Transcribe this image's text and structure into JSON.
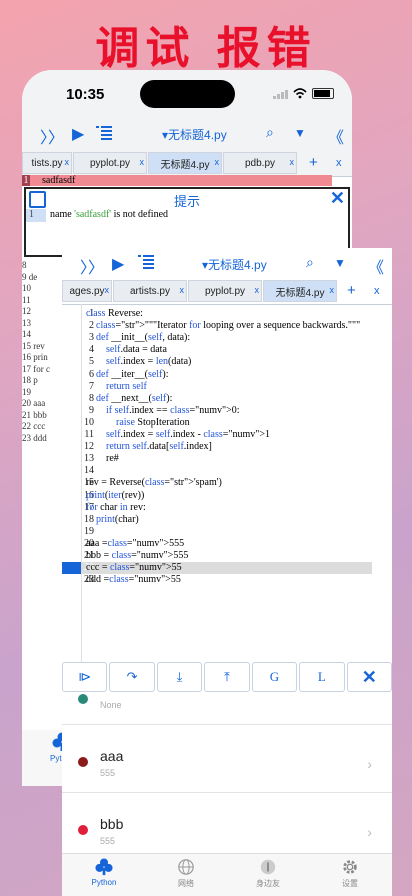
{
  "headline": "调试 报错",
  "status": {
    "time": "10:35"
  },
  "toolbar": {
    "filename": "无标题4.py",
    "filename_front": "无标题4.py"
  },
  "back_tabs": [
    {
      "label": "tists.py"
    },
    {
      "label": "pyplot.py"
    },
    {
      "label": "无标题4.py"
    },
    {
      "label": "pdb.py"
    }
  ],
  "tab_close": "x",
  "error_line": {
    "num": "1",
    "text": "sadfasdf"
  },
  "prompt": {
    "title": "提示",
    "line_num": "1",
    "msg_pre": "name ",
    "msg_name": "'sadfasdf'",
    "msg_post": " is not defined"
  },
  "back_code_lines": [
    "8",
    "9      de",
    "10",
    "11",
    "12",
    "13",
    "14",
    "15    rev",
    "16    prin",
    "17    for c",
    "18        p",
    "19",
    "20    aaa",
    "21    bbb",
    "22    ccc",
    "23    ddd"
  ],
  "back_tabbar": {
    "python": "Pyt"
  },
  "front_tabs": [
    {
      "label": "ages.py"
    },
    {
      "label": "artists.py"
    },
    {
      "label": "pyplot.py"
    },
    {
      "label": "无标题4.py"
    }
  ],
  "code": [
    {
      "n": "1",
      "t": "class Reverse:"
    },
    {
      "n": "2",
      "t": "    \"\"\"Iterator for looping over a sequence backwards.\"\"\""
    },
    {
      "n": "3",
      "t": "    def __init__(self, data):"
    },
    {
      "n": "4",
      "t": "        self.data = data"
    },
    {
      "n": "5",
      "t": "        self.index = len(data)"
    },
    {
      "n": "6",
      "t": "    def __iter__(self):"
    },
    {
      "n": "7",
      "t": "        return self"
    },
    {
      "n": "8",
      "t": "    def __next__(self):"
    },
    {
      "n": "9",
      "t": "        if self.index == 0:"
    },
    {
      "n": "10",
      "t": "            raise StopIteration"
    },
    {
      "n": "11",
      "t": "        self.index = self.index - 1"
    },
    {
      "n": "12",
      "t": "        return self.data[self.index]"
    },
    {
      "n": "13",
      "t": "        re#"
    },
    {
      "n": "14",
      "t": ""
    },
    {
      "n": "15",
      "t": "rev = Reverse('spam')"
    },
    {
      "n": "16",
      "t": "print(iter(rev))"
    },
    {
      "n": "17",
      "t": "for char in rev:"
    },
    {
      "n": "18",
      "t": "    print(char)"
    },
    {
      "n": "19",
      "t": ""
    },
    {
      "n": "20",
      "t": "aaa =555"
    },
    {
      "n": "21",
      "t": "bbb = 555"
    },
    {
      "n": "22",
      "t": "ccc = 55"
    },
    {
      "n": "23",
      "t": "ddd =55"
    }
  ],
  "debug_buttons": [
    "step-in",
    "step-over",
    "step-down",
    "step-up",
    "G",
    "L",
    "close"
  ],
  "variables": [
    {
      "name": "",
      "value": "None",
      "color": "#2a8a7a"
    },
    {
      "name": "aaa",
      "value": "555",
      "color": "#8b1a1a"
    },
    {
      "name": "bbb",
      "value": "555",
      "color": "#e0203a"
    }
  ],
  "tabbar": [
    {
      "label": "Python",
      "icon": "python-icon",
      "active": true
    },
    {
      "label": "网络",
      "icon": "globe-icon"
    },
    {
      "label": "身边友",
      "icon": "person-icon"
    },
    {
      "label": "设置",
      "icon": "gear-icon"
    }
  ]
}
